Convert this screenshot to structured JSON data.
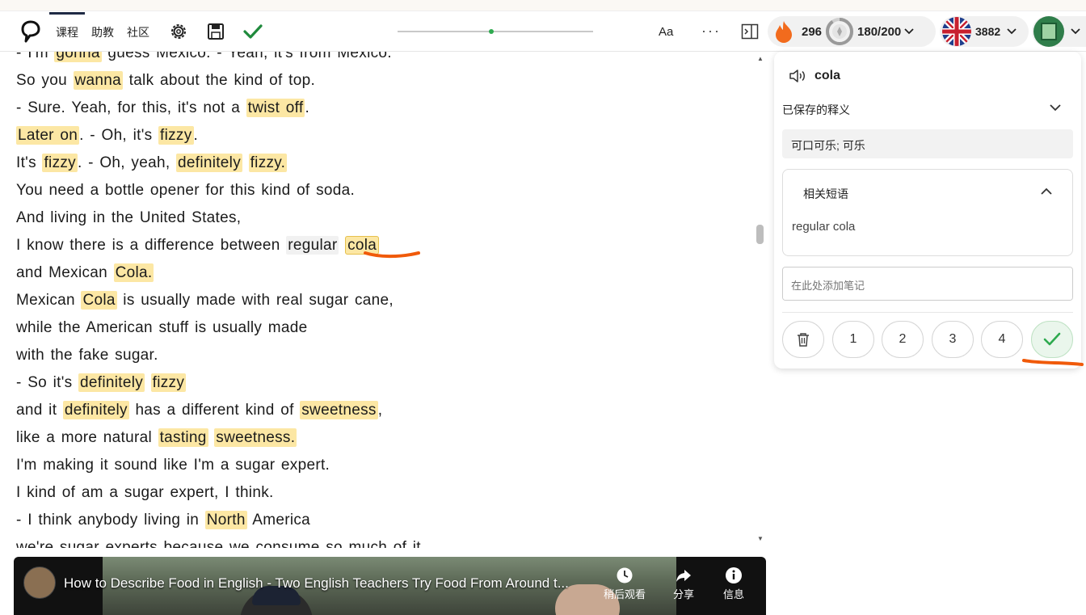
{
  "toolbar": {
    "tabs": [
      {
        "label": "课程",
        "active": true
      },
      {
        "label": "助教",
        "active": false
      },
      {
        "label": "社区",
        "active": false
      }
    ],
    "font_button": "Aa",
    "more_button": "···",
    "slider_value_fraction": 0.48,
    "streak": "296",
    "daily_goal": "180/200",
    "language_points": "3882",
    "icons": [
      "logo-icon",
      "gear-icon",
      "save-icon",
      "check-icon",
      "sidebar-toggle-icon",
      "flame-icon",
      "goal-ring-icon",
      "uk-flag-icon",
      "avatar-icon"
    ]
  },
  "transcript": {
    "lines": [
      [
        {
          "t": "- I'm "
        },
        {
          "t": "gonna",
          "h": 1
        },
        {
          "t": " guess Mexico. - Yeah, it's from Mexico."
        }
      ],
      [
        {
          "t": "So you "
        },
        {
          "t": "wanna",
          "h": 1
        },
        {
          "t": " talk about the kind of top."
        }
      ],
      [
        {
          "t": "- Sure. Yeah, for this, it's not a "
        },
        {
          "t": "twist off",
          "h": 1
        },
        {
          "t": "."
        }
      ],
      [
        {
          "t": "Later on",
          "h": 1
        },
        {
          "t": ". - Oh, it's "
        },
        {
          "t": "fizzy",
          "h": 1
        },
        {
          "t": "."
        }
      ],
      [
        {
          "t": "It's "
        },
        {
          "t": "fizzy",
          "h": 1
        },
        {
          "t": ". - Oh, yeah, "
        },
        {
          "t": "definitely",
          "h": 1
        },
        {
          "t": " "
        },
        {
          "t": "fizzy.",
          "h": 1
        }
      ],
      [
        {
          "t": "You need a bottle opener for this kind of soda."
        }
      ],
      [
        {
          "t": "And living in the United States,"
        }
      ],
      [
        {
          "t": "I know there is a difference between "
        },
        {
          "t": "regular",
          "g": 1
        },
        {
          "t": " "
        },
        {
          "t": "cola",
          "s": 1
        }
      ],
      [
        {
          "t": "and Mexican "
        },
        {
          "t": "Cola.",
          "h": 1
        }
      ],
      [
        {
          "t": "Mexican "
        },
        {
          "t": "Cola",
          "h": 1
        },
        {
          "t": " is usually made with real sugar cane,"
        }
      ],
      [
        {
          "t": "while the American stuff is usually made"
        }
      ],
      [
        {
          "t": "with the fake sugar."
        }
      ],
      [
        {
          "t": "- So it's "
        },
        {
          "t": "definitely",
          "h": 1
        },
        {
          "t": " "
        },
        {
          "t": "fizzy",
          "h": 1
        }
      ],
      [
        {
          "t": "and it "
        },
        {
          "t": "definitely",
          "h": 1
        },
        {
          "t": " has a different kind of "
        },
        {
          "t": "sweetness",
          "h": 1
        },
        {
          "t": ","
        }
      ],
      [
        {
          "t": "like a more natural "
        },
        {
          "t": "tasting",
          "h": 1
        },
        {
          "t": " "
        },
        {
          "t": "sweetness.",
          "h": 1
        }
      ],
      [
        {
          "t": "I'm making it sound like I'm a sugar expert."
        }
      ],
      [
        {
          "t": "I kind of am a sugar expert, I think."
        }
      ],
      [
        {
          "t": "- I think anybody living in "
        },
        {
          "t": "North",
          "h": 1
        },
        {
          "t": " America"
        }
      ],
      [
        {
          "t": "we're sugar experts because we consume so much of it."
        }
      ]
    ]
  },
  "video": {
    "title": "How to Describe Food in English - Two English Teachers Try Food From Around t...",
    "watch_later": "稍后观看",
    "share": "分享",
    "info": "信息"
  },
  "panel": {
    "word": "cola",
    "saved_label": "已保存的释义",
    "definition": "可口可乐; 可乐",
    "phrases_title": "相关短语",
    "phrases": [
      "regular cola"
    ],
    "note_placeholder": "在此处添加笔记",
    "ratings": [
      "1",
      "2",
      "3",
      "4"
    ],
    "accent_green": "#2eaa4f",
    "highlight_color": "#fce7a4"
  }
}
